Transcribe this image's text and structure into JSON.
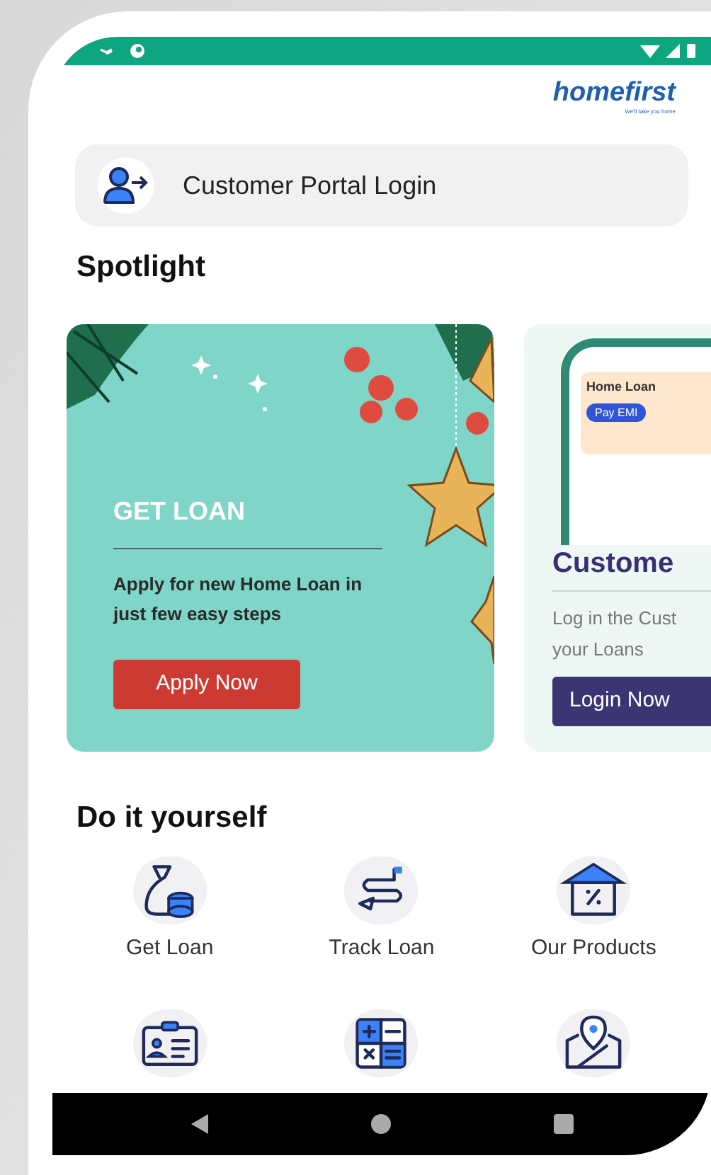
{
  "brand": {
    "name": "homefirst",
    "tagline": "We'll take you home"
  },
  "login_bar": {
    "label": "Customer Portal Login"
  },
  "spotlight": {
    "title": "Spotlight",
    "cards": [
      {
        "kind": "promo",
        "title": "GET LOAN",
        "text": "Apply for new Home Loan in just few easy steps",
        "button": "Apply Now"
      },
      {
        "kind": "portal",
        "mock_title": "Home Loan",
        "mock_button": "Pay EMI",
        "title": "Custome",
        "text_lines": [
          "Log in the Cust",
          "your Loans"
        ],
        "button": "Login Now"
      }
    ]
  },
  "diy": {
    "title": "Do it yourself",
    "items": [
      {
        "kind": "money-bag",
        "label": "Get Loan"
      },
      {
        "kind": "route",
        "label": "Track Loan"
      },
      {
        "kind": "house",
        "label": "Our Products"
      },
      {
        "kind": "id-card"
      },
      {
        "kind": "calculator"
      },
      {
        "kind": "map"
      }
    ]
  }
}
